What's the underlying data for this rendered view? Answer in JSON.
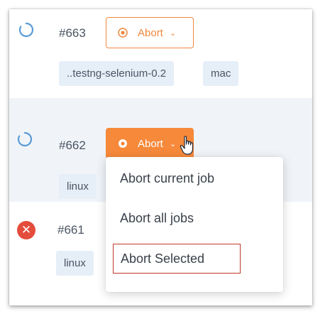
{
  "jobs": [
    {
      "id": "#663",
      "status": "running",
      "tags": [
        "..testng-selenium-0.2",
        "mac"
      ]
    },
    {
      "id": "#662",
      "status": "running",
      "tags": [
        "linux"
      ]
    },
    {
      "id": "#661",
      "status": "failed",
      "tags": [
        "linux"
      ]
    }
  ],
  "abort_button": {
    "label": "Abort",
    "chevron": "⌄"
  },
  "abort_menu": {
    "items": [
      "Abort current job",
      "Abort all jobs",
      "Abort Selected"
    ],
    "highlighted": "Abort Selected"
  },
  "icons": {
    "running": "spinner-icon",
    "failed": "error-x-icon",
    "stop": "stop-circle-icon",
    "pointer": "hand-cursor-icon"
  },
  "colors": {
    "accent": "#f6893a",
    "failed": "#e44c3b",
    "spinner": "#5a9ad6",
    "tag_bg": "#e6eef8",
    "highlight_border": "#c0392b"
  }
}
